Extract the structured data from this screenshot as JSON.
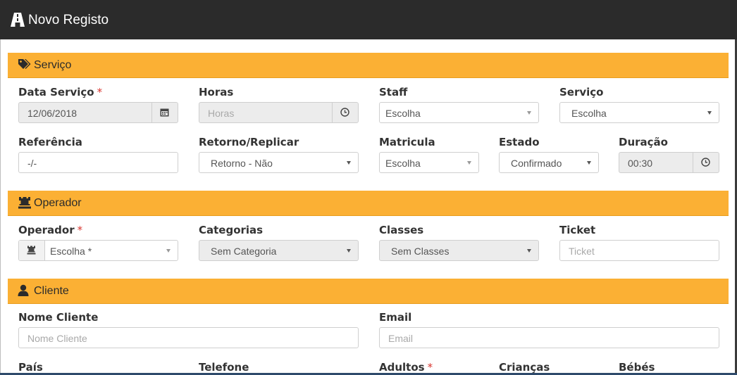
{
  "app": {
    "title": "Novo Registo",
    "logo_icon": "road-icon"
  },
  "colors": {
    "header_bg": "#2b2b2b",
    "section_bg": "#fbb034",
    "required": "#d9352f"
  },
  "sections": {
    "servico": {
      "title": "Serviço",
      "icon": "tags-icon"
    },
    "operador": {
      "title": "Operador",
      "icon": "chess-rook-icon"
    },
    "cliente": {
      "title": "Cliente",
      "icon": "user-icon"
    }
  },
  "servico": {
    "data_servico": {
      "label": "Data Serviço",
      "value": "12/06/2018",
      "required_mark": "*",
      "icon": "calendar-icon"
    },
    "horas": {
      "label": "Horas",
      "placeholder": "Horas",
      "icon": "clock-icon"
    },
    "staff": {
      "label": "Staff",
      "selected": "Escolha"
    },
    "servico_select": {
      "label": "Serviço",
      "selected": "Escolha"
    },
    "referencia": {
      "label": "Referência",
      "value": "-/-"
    },
    "retorno": {
      "label": "Retorno/Replicar",
      "selected": "Retorno - Não"
    },
    "matricula": {
      "label": "Matricula",
      "selected": "Escolha"
    },
    "estado": {
      "label": "Estado",
      "selected": "Confirmado"
    },
    "duracao": {
      "label": "Duração",
      "value": "00:30",
      "icon": "clock-icon"
    }
  },
  "operador": {
    "operador": {
      "label": "Operador",
      "required_mark": "*",
      "selected": "Escolha *",
      "icon": "chess-rook-icon"
    },
    "categorias": {
      "label": "Categorias",
      "selected": "Sem Categoria"
    },
    "classes": {
      "label": "Classes",
      "selected": "Sem Classes"
    },
    "ticket": {
      "label": "Ticket",
      "placeholder": "Ticket"
    }
  },
  "cliente": {
    "nome": {
      "label": "Nome Cliente",
      "placeholder": "Nome Cliente"
    },
    "email": {
      "label": "Email",
      "placeholder": "Email"
    },
    "pais": {
      "label": "País"
    },
    "telefone": {
      "label": "Telefone"
    },
    "adultos": {
      "label": "Adultos",
      "required_mark": "*"
    },
    "criancas": {
      "label": "Crianças"
    },
    "bebes": {
      "label": "Bébés"
    }
  }
}
